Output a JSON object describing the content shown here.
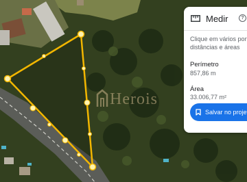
{
  "panel": {
    "title": "Medir",
    "help_symbol": "?",
    "instruction_line1": "Clique em vários pontos",
    "instruction_line2": "distâncias e áreas",
    "perimeter_label": "Perímetro",
    "perimeter_value": "857,86 m",
    "area_label": "Área",
    "area_value": "33.006,77 m²",
    "save_label": "Salvar no projeto"
  },
  "watermark": "Herois",
  "colors": {
    "measurement_line": "#f2b600",
    "vertex": "#fff3b0",
    "button": "#1a73e8",
    "water": "#4fb3c8"
  },
  "icons": [
    "ruler-icon",
    "help-icon",
    "bookmark-icon"
  ]
}
